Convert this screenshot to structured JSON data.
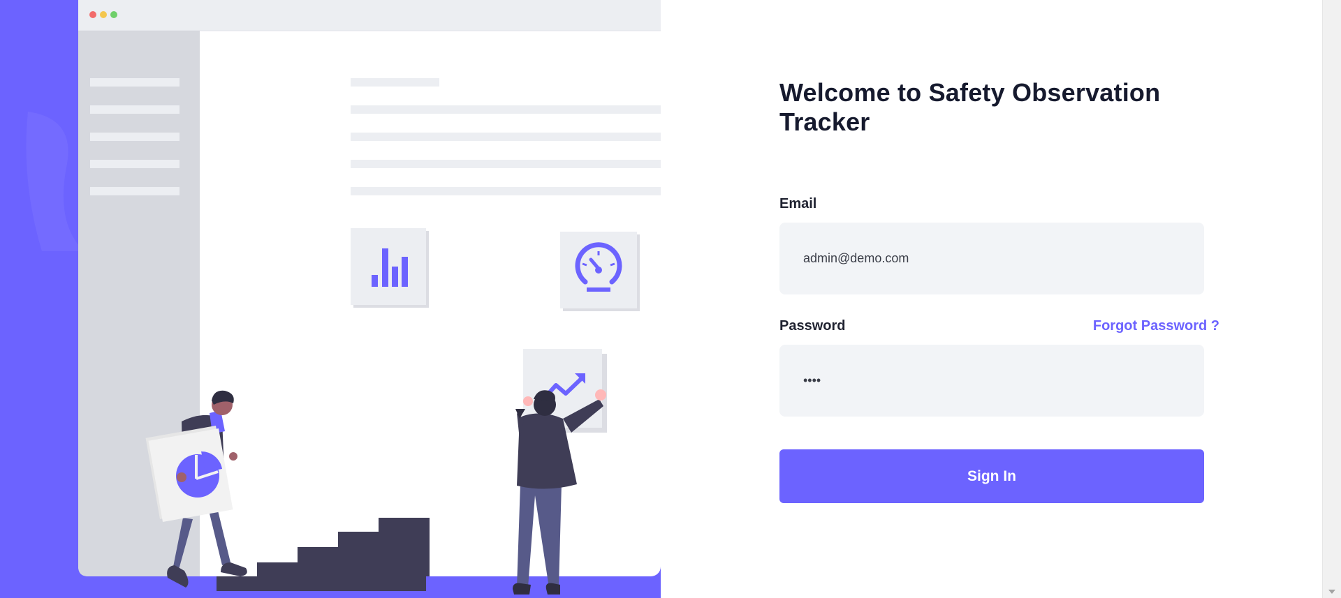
{
  "login": {
    "title": "Welcome to Safety Observation Tracker",
    "email_label": "Email",
    "email_value": "admin@demo.com",
    "password_label": "Password",
    "password_value": "••••",
    "forgot_password_label": "Forgot Password ?",
    "sign_in_label": "Sign In"
  },
  "colors": {
    "accent": "#6c63ff",
    "input_background": "#f2f4f7",
    "title_text": "#161a2e"
  },
  "icons": {
    "browser_dots": "window-controls",
    "chart": "bar-chart-icon",
    "gauge": "speedometer-icon",
    "trend": "trending-up-icon",
    "pie": "pie-chart-icon"
  }
}
